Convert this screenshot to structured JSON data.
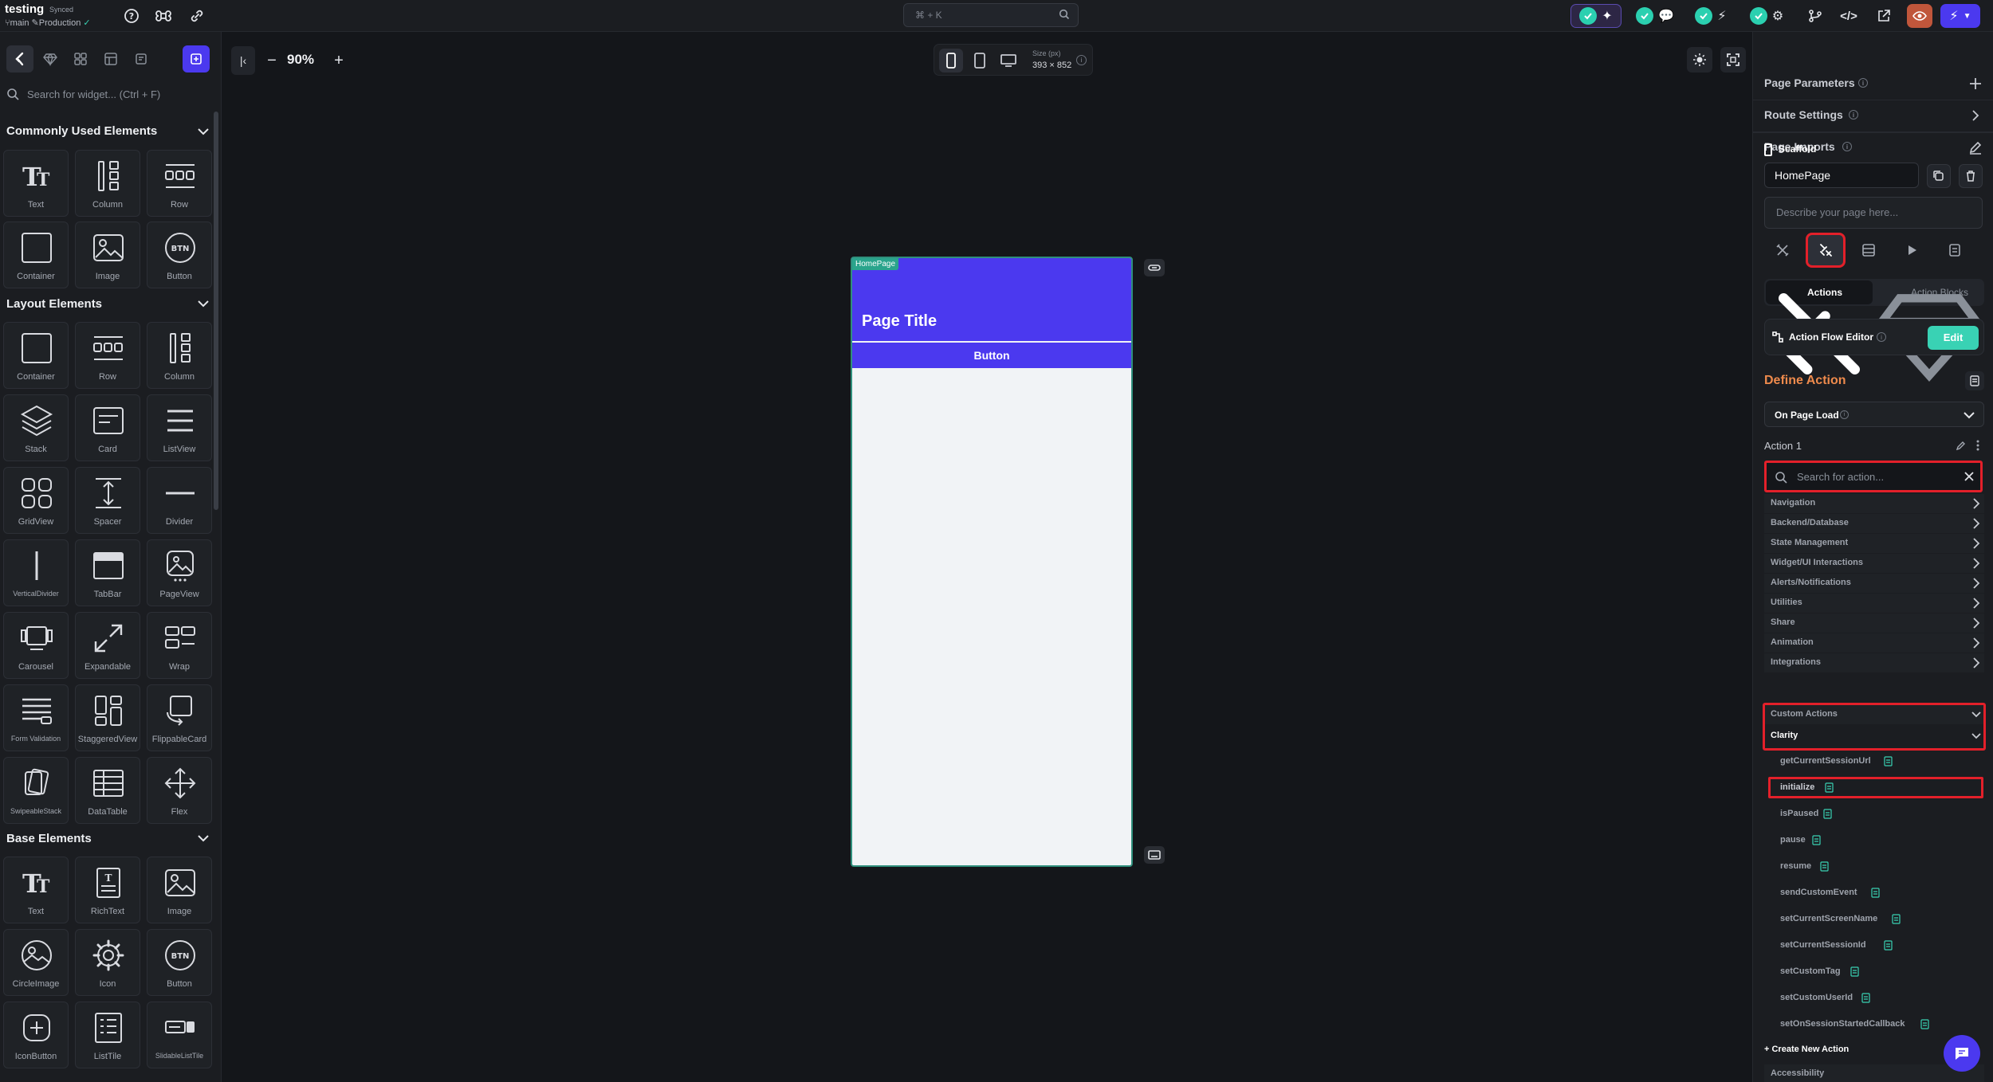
{
  "topbar": {
    "project_name": "testing",
    "sync_status": "Synced",
    "branch": "main",
    "environment": "Production",
    "command_palette": "⌘ + K"
  },
  "left_panel": {
    "search_placeholder": "Search for widget... (Ctrl + F)",
    "sections": [
      {
        "title": "Commonly Used Elements",
        "items": [
          "Text",
          "Column",
          "Row",
          "Container",
          "Image",
          "Button"
        ]
      },
      {
        "title": "Layout Elements",
        "items": [
          "Container",
          "Row",
          "Column",
          "Stack",
          "Card",
          "ListView",
          "GridView",
          "Spacer",
          "Divider",
          "VerticalDivider",
          "TabBar",
          "PageView",
          "Carousel",
          "Expandable",
          "Wrap",
          "Form Validation",
          "StaggeredView",
          "FlippableCard",
          "SwipeableStack",
          "DataTable",
          "Flex"
        ]
      },
      {
        "title": "Base Elements",
        "items": [
          "Text",
          "RichText",
          "Image",
          "CircleImage",
          "Icon",
          "Button",
          "IconButton",
          "ListTile",
          "SlidableListTile"
        ]
      }
    ]
  },
  "canvas": {
    "zoom": "90%",
    "size_label": "Size (px)",
    "size_value": "393 × 852",
    "phone": {
      "page_tag": "HomePage",
      "title": "Page Title",
      "button_label": "Button"
    }
  },
  "right_panel": {
    "page_parameters": "Page Parameters",
    "route_settings": "Route Settings",
    "page_imports": "Page Imports",
    "scaffold": "Scaffold",
    "page_name": "HomePage",
    "describe_placeholder": "Describe your page here...",
    "tab_actions": "Actions",
    "tab_action_blocks": "Action Blocks",
    "action_flow_editor": "Action Flow Editor",
    "edit": "Edit",
    "define_action": "Define Action",
    "trigger": "On Page Load",
    "action_name": "Action 1",
    "action_search_placeholder": "Search for action...",
    "categories": [
      "Navigation",
      "Backend/Database",
      "State Management",
      "Widget/UI Interactions",
      "Alerts/Notifications",
      "Utilities",
      "Share",
      "Animation",
      "Integrations"
    ],
    "custom_actions": "Custom Actions",
    "clarity": "Clarity",
    "clarity_actions": [
      "getCurrentSessionUrl",
      "initialize",
      "isPaused",
      "pause",
      "resume",
      "sendCustomEvent",
      "setCurrentScreenName",
      "setCurrentSessionId",
      "setCustomTag",
      "setCustomUserId",
      "setOnSessionStartedCallback"
    ],
    "create_new_action": "+ Create New Action",
    "accessibility": "Accessibility"
  },
  "colors": {
    "accent": "#4b39ef",
    "teal": "#39d2b4",
    "highlight": "#e3202a",
    "define_action": "#ee8a4c"
  }
}
